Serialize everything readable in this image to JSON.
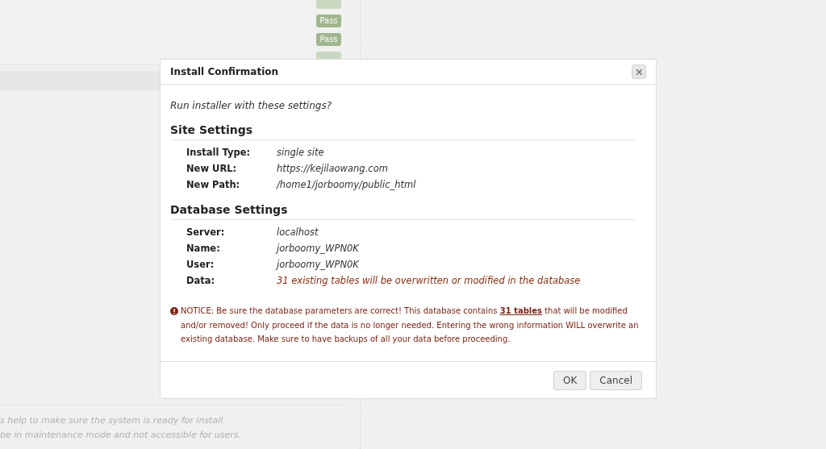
{
  "background": {
    "badges": [
      {
        "label": "Pass"
      },
      {
        "label": "Pass"
      }
    ],
    "notes": [
      "s help to make sure the system is ready for install.",
      "be in maintenance mode and not accessible for users."
    ]
  },
  "dialog": {
    "title": "Install Confirmation",
    "prompt": "Run installer with these settings?",
    "sections": [
      {
        "title": "Site Settings",
        "rows": [
          {
            "label": "Install Type:",
            "value": "single site",
            "kind": "normal"
          },
          {
            "label": "New URL:",
            "value": "https://kejilaowang.com",
            "kind": "normal"
          },
          {
            "label": "New Path:",
            "value": "/home1/jorboomy/public_html",
            "kind": "normal"
          }
        ]
      },
      {
        "title": "Database Settings",
        "rows": [
          {
            "label": "Server:",
            "value": "localhost",
            "kind": "normal"
          },
          {
            "label": "Name:",
            "value": "jorboomy_WPN0K",
            "kind": "normal"
          },
          {
            "label": "User:",
            "value": "jorboomy_WPN0K",
            "kind": "normal"
          },
          {
            "label": "Data:",
            "value": "31 existing tables will be overwritten or modified in the database",
            "kind": "warning"
          }
        ]
      }
    ],
    "notice": "NOTICE: Be sure the database parameters are correct! This database contains **31 tables** that will be modified and/or removed! Only proceed if the data is no longer needed. Entering the wrong information WILL overwrite an existing database. Make sure to have backups of all your data before proceeding.",
    "buttons": [
      {
        "label": "OK"
      },
      {
        "label": "Cancel"
      }
    ]
  }
}
